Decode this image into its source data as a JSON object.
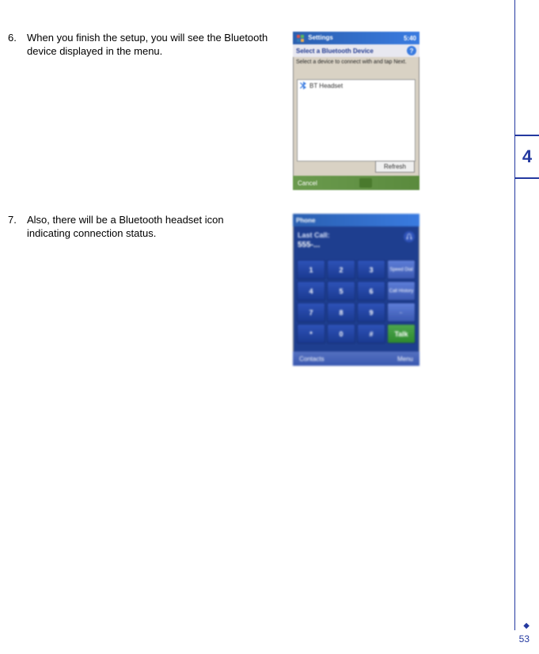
{
  "chapter": {
    "number": "4"
  },
  "page": {
    "number": "53",
    "ornament": "◆"
  },
  "steps": [
    {
      "num": "6.",
      "text": "When you finish the setup, you will see the Bluetooth device displayed in the menu."
    },
    {
      "num": "7.",
      "text": "Also, there will be a Bluetooth headset icon indicating connection status."
    }
  ],
  "screenshot1": {
    "title_app": "Settings",
    "title_right": "5:40",
    "subtitle": "Select a Bluetooth Device",
    "help": "?",
    "instruction": "Select a device to connect with and tap Next.",
    "device_name": "BT Headset",
    "refresh": "Refresh",
    "soft_left": "Cancel",
    "soft_right": " "
  },
  "screenshot2": {
    "title_app": "Phone",
    "title_right": " ",
    "lastcall_label": "Last Call:",
    "lastcall_number": "555-...",
    "keys": [
      "1",
      "2",
      "3",
      "4",
      "5",
      "6",
      "7",
      "8",
      "9",
      "*",
      "0",
      "#"
    ],
    "side": {
      "speed": "Speed Dial",
      "history": "Call History",
      "back": "←",
      "talk": "Talk"
    },
    "soft_left": "Contacts",
    "soft_right": "Menu"
  }
}
